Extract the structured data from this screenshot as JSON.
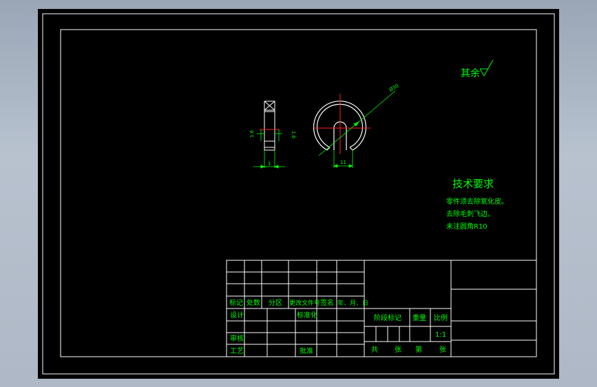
{
  "drawing": {
    "roughness_label": "其余",
    "diameter_label": "Ø30",
    "side_dims": {
      "left": "1.6",
      "right": "1.6",
      "bottom": "1"
    },
    "front_dim_bottom": "11"
  },
  "tech_requirements": {
    "title": "技术要求",
    "items": [
      "零件须去除氧化皮。",
      "去除毛刺飞边。",
      "未注圆角R10"
    ]
  },
  "title_block": {
    "rev_headers": [
      "标记",
      "处数",
      "分区",
      "更改文件号",
      "签名",
      "年、月、日"
    ],
    "design": "设计",
    "standardize": "标准化",
    "review": "审核",
    "process": "工艺",
    "approve": "批准",
    "stage_mark": "阶段标记",
    "weight": "重量",
    "scale": "比例",
    "scale_value": "1:1",
    "sheet_total": "共",
    "sheet_unit1": "张",
    "sheet_no": "第",
    "sheet_unit2": "张"
  },
  "colors": {
    "line": "#ffffff",
    "text": "#00ff00",
    "center": "#ff2020",
    "dim": "#00ff00",
    "background": "#000000"
  }
}
